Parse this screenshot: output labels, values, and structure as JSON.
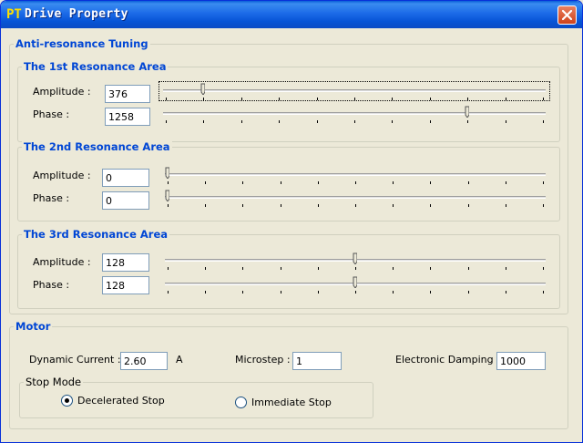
{
  "window": {
    "title": "Drive Property",
    "icon_text": "PT",
    "icon": "app-pt-icon",
    "close_icon": "close-icon"
  },
  "anti_resonance": {
    "legend": "Anti-resonance Tuning",
    "area1": {
      "legend": "The 1st Resonance Area",
      "amplitude": {
        "label": "Amplitude :",
        "value": "376",
        "slider_level": 0.1
      },
      "phase": {
        "label": "Phase :",
        "value": "1258",
        "slider_level": 0.8
      }
    },
    "area2": {
      "legend": "The 2nd Resonance Area",
      "amplitude": {
        "label": "Amplitude :",
        "value": "0",
        "slider_level": 0.0
      },
      "phase": {
        "label": "Phase :",
        "value": "0",
        "slider_level": 0.0
      }
    },
    "area3": {
      "legend": "The 3rd Resonance Area",
      "amplitude": {
        "label": "Amplitude :",
        "value": "128",
        "slider_level": 0.5
      },
      "phase": {
        "label": "Phase :",
        "value": "128",
        "slider_level": 0.5
      }
    }
  },
  "motor": {
    "legend": "Motor",
    "dynamic_current": {
      "label": "Dynamic Current :",
      "value": "2.60",
      "unit": "A"
    },
    "microstep": {
      "label": "Microstep :",
      "value": "1"
    },
    "electronic_damping": {
      "label": "Electronic Damping :",
      "value": "1000"
    },
    "stop_mode": {
      "legend": "Stop Mode",
      "options": [
        {
          "label": "Decelerated Stop",
          "selected": true
        },
        {
          "label": "Immediate Stop",
          "selected": false
        }
      ]
    }
  },
  "colors": {
    "legend_blue": "#0046d5",
    "title_blue": "#0a5ed8",
    "close_red": "#d0421a"
  }
}
